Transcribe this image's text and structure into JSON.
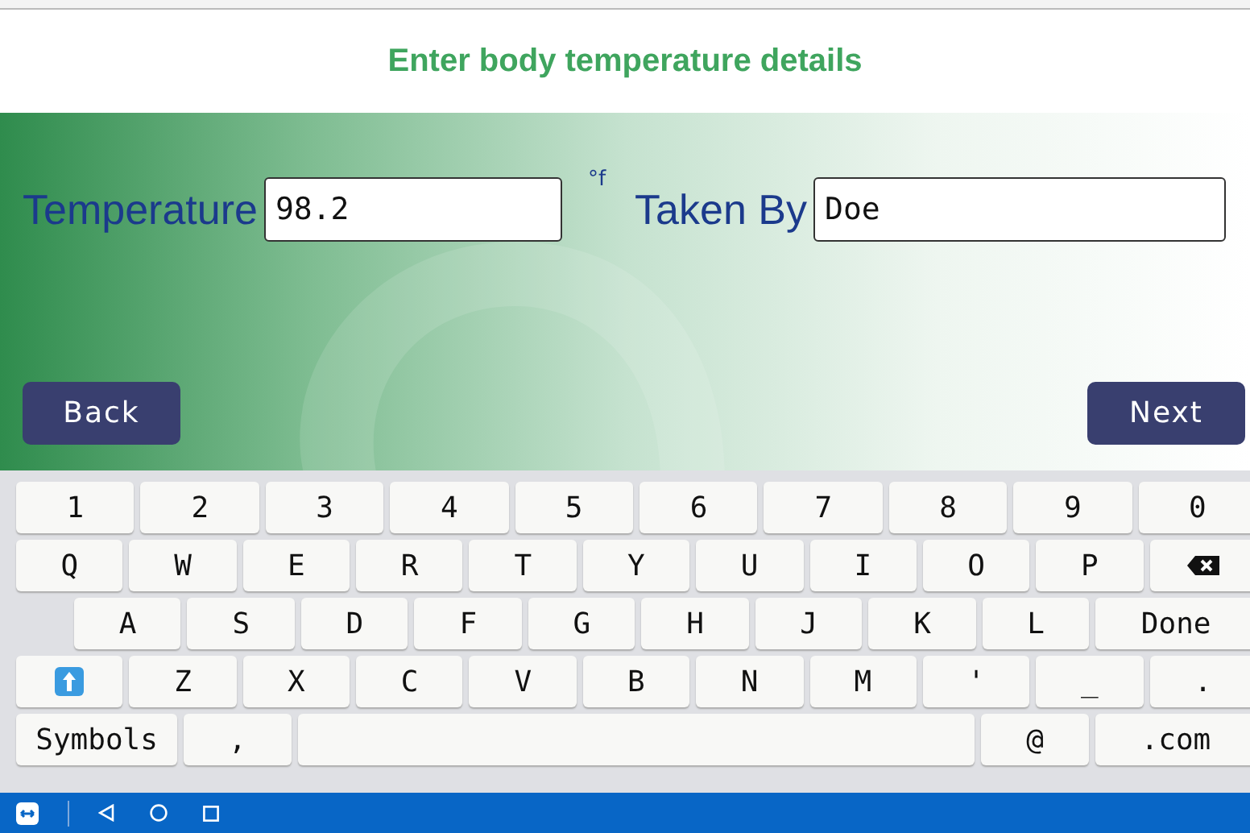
{
  "header": {
    "title": "Enter body temperature details"
  },
  "form": {
    "fields": [
      {
        "label": "Temperature",
        "value": "98.2",
        "unit": "°f"
      },
      {
        "label": "Taken By",
        "value": "Doe"
      }
    ]
  },
  "buttons": [
    {
      "label": "Back"
    },
    {
      "label": "Next"
    }
  ],
  "keyboard": {
    "rows": [
      {
        "keys": [
          {
            "label": "1"
          },
          {
            "label": "2"
          },
          {
            "label": "3"
          },
          {
            "label": "4"
          },
          {
            "label": "5"
          },
          {
            "label": "6"
          },
          {
            "label": "7"
          },
          {
            "label": "8"
          },
          {
            "label": "9"
          },
          {
            "label": "0"
          }
        ]
      },
      {
        "keys": [
          {
            "label": "Q"
          },
          {
            "label": "W"
          },
          {
            "label": "E"
          },
          {
            "label": "R"
          },
          {
            "label": "T"
          },
          {
            "label": "Y"
          },
          {
            "label": "U"
          },
          {
            "label": "I"
          },
          {
            "label": "O"
          },
          {
            "label": "P"
          },
          {
            "kind": "backspace"
          }
        ]
      },
      {
        "indented": true,
        "keys": [
          {
            "label": "A"
          },
          {
            "label": "S"
          },
          {
            "label": "D"
          },
          {
            "label": "F"
          },
          {
            "label": "G"
          },
          {
            "label": "H"
          },
          {
            "label": "J"
          },
          {
            "label": "K"
          },
          {
            "label": "L"
          },
          {
            "label": "Done",
            "kind": "wide"
          }
        ]
      },
      {
        "keys": [
          {
            "kind": "shift"
          },
          {
            "label": "Z"
          },
          {
            "label": "X"
          },
          {
            "label": "C"
          },
          {
            "label": "V"
          },
          {
            "label": "B"
          },
          {
            "label": "N"
          },
          {
            "label": "M"
          },
          {
            "label": "'"
          },
          {
            "label": "_"
          },
          {
            "label": "."
          }
        ]
      },
      {
        "keys": [
          {
            "label": "Symbols",
            "kind": "wide"
          },
          {
            "label": ","
          },
          {
            "kind": "space"
          },
          {
            "label": "@"
          },
          {
            "label": ".com",
            "kind": "wide"
          }
        ]
      }
    ]
  }
}
